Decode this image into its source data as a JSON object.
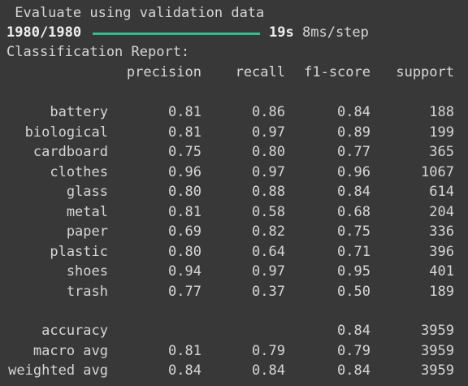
{
  "header": {
    "evaluate_line": " Evaluate using validation data",
    "steps": "1980/1980",
    "progress": 1.0,
    "time": "19s",
    "per_step": "8ms/step",
    "report_title": "Classification Report:"
  },
  "report": {
    "columns": [
      "precision",
      "recall",
      "f1-score",
      "support"
    ],
    "rows": [
      {
        "label": "battery",
        "precision": "0.81",
        "recall": "0.86",
        "f1": "0.84",
        "support": "188"
      },
      {
        "label": "biological",
        "precision": "0.81",
        "recall": "0.97",
        "f1": "0.89",
        "support": "199"
      },
      {
        "label": "cardboard",
        "precision": "0.75",
        "recall": "0.80",
        "f1": "0.77",
        "support": "365"
      },
      {
        "label": "clothes",
        "precision": "0.96",
        "recall": "0.97",
        "f1": "0.96",
        "support": "1067"
      },
      {
        "label": "glass",
        "precision": "0.80",
        "recall": "0.88",
        "f1": "0.84",
        "support": "614"
      },
      {
        "label": "metal",
        "precision": "0.81",
        "recall": "0.58",
        "f1": "0.68",
        "support": "204"
      },
      {
        "label": "paper",
        "precision": "0.69",
        "recall": "0.82",
        "f1": "0.75",
        "support": "336"
      },
      {
        "label": "plastic",
        "precision": "0.80",
        "recall": "0.64",
        "f1": "0.71",
        "support": "396"
      },
      {
        "label": "shoes",
        "precision": "0.94",
        "recall": "0.97",
        "f1": "0.95",
        "support": "401"
      },
      {
        "label": "trash",
        "precision": "0.77",
        "recall": "0.37",
        "f1": "0.50",
        "support": "189"
      }
    ],
    "summary": [
      {
        "label": "accuracy",
        "precision": "",
        "recall": "",
        "f1": "0.84",
        "support": "3959"
      },
      {
        "label": "macro avg",
        "precision": "0.81",
        "recall": "0.79",
        "f1": "0.79",
        "support": "3959"
      },
      {
        "label": "weighted avg",
        "precision": "0.84",
        "recall": "0.84",
        "f1": "0.84",
        "support": "3959"
      }
    ]
  }
}
